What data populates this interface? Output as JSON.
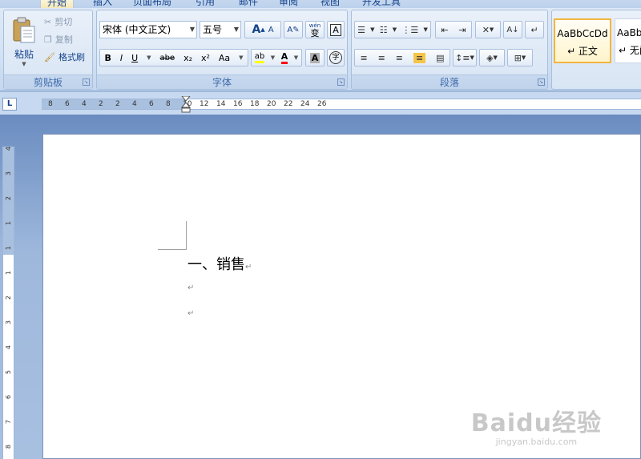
{
  "tabs": [
    "开始",
    "插入",
    "页面布局",
    "引用",
    "邮件",
    "审阅",
    "视图",
    "开发工具"
  ],
  "clipboard": {
    "paste_label": "粘贴",
    "cut_label": "剪切",
    "copy_label": "复制",
    "format_painter_label": "格式刷",
    "group_label": "剪贴板"
  },
  "font": {
    "name": "宋体 (中文正文)",
    "size": "五号",
    "grow_label": "A",
    "shrink_label": "A",
    "clear_label": "A",
    "wen_label": "wén",
    "wen_char": "变",
    "border_label": "A",
    "bold": "B",
    "italic": "I",
    "underline": "U",
    "strike": "abe",
    "subscript": "x₂",
    "superscript": "x²",
    "case": "Aa",
    "highlight": "ab",
    "font_color": "A",
    "shade": "A",
    "enclose": "字",
    "group_label": "字体"
  },
  "paragraph": {
    "group_label": "段落"
  },
  "styles": {
    "items": [
      {
        "sample": "AaBbCcDd",
        "name": "↵ 正文"
      },
      {
        "sample": "AaBbC",
        "name": "↵ 无间"
      }
    ]
  },
  "ruler": {
    "h_labels": [
      "8",
      "6",
      "4",
      "2",
      "2",
      "4",
      "6",
      "8",
      "10",
      "12",
      "14",
      "16",
      "18",
      "20",
      "22",
      "24",
      "26"
    ],
    "v_labels": [
      "4",
      "3",
      "2",
      "1",
      "1",
      "1",
      "2",
      "3",
      "4",
      "5",
      "6",
      "7",
      "8"
    ],
    "corner": "L"
  },
  "document": {
    "heading": "一、销售",
    "para_mark": "↵"
  },
  "watermark": {
    "brand": "Baidu经验",
    "url": "jingyan.baidu.com"
  },
  "colors": {
    "highlight": "#ffff00",
    "font_color": "#ff0000",
    "selected_style_border": "#f0b640"
  }
}
